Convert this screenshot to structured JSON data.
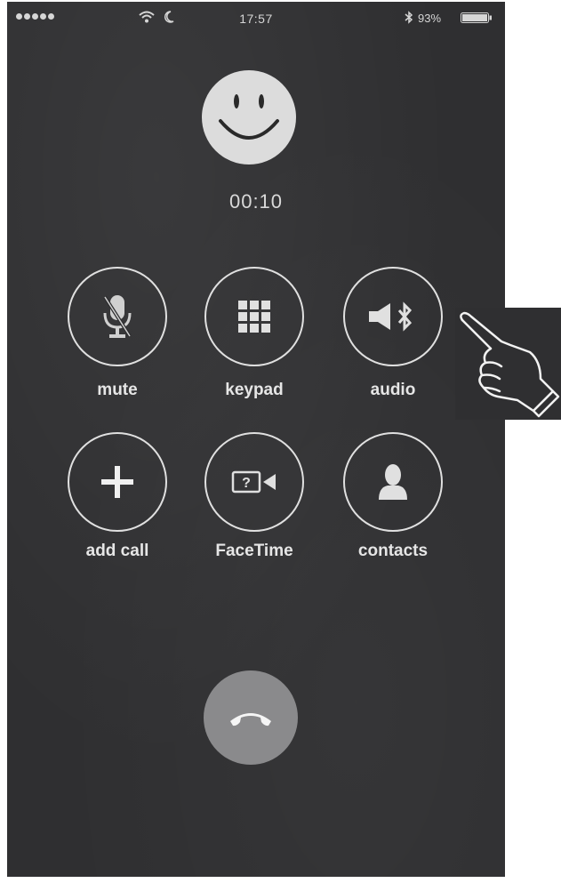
{
  "status_bar": {
    "time": "17:57",
    "battery_percent": "93%",
    "icons": [
      "signal-dots-icon",
      "wifi-icon",
      "moon-icon",
      "bluetooth-icon",
      "battery-icon"
    ]
  },
  "call": {
    "avatar_icon": "smiley-face-icon",
    "timer": "00:10"
  },
  "controls": [
    {
      "label": "mute",
      "icon": "microphone-muted-icon"
    },
    {
      "label": "keypad",
      "icon": "keypad-grid-icon"
    },
    {
      "label": "audio",
      "icon": "speaker-bluetooth-icon"
    },
    {
      "label": "add call",
      "icon": "plus-icon"
    },
    {
      "label": "FaceTime",
      "icon": "facetime-camera-icon"
    },
    {
      "label": "contacts",
      "icon": "contact-person-icon"
    }
  ],
  "end_call": {
    "icon": "end-call-phone-icon",
    "color": "#8a8a8c"
  },
  "annotation": {
    "icon": "pointing-hand-icon"
  },
  "colors": {
    "background": "#2f2f31",
    "ring": "#e0e0e0",
    "text": "#e6e6e6"
  }
}
